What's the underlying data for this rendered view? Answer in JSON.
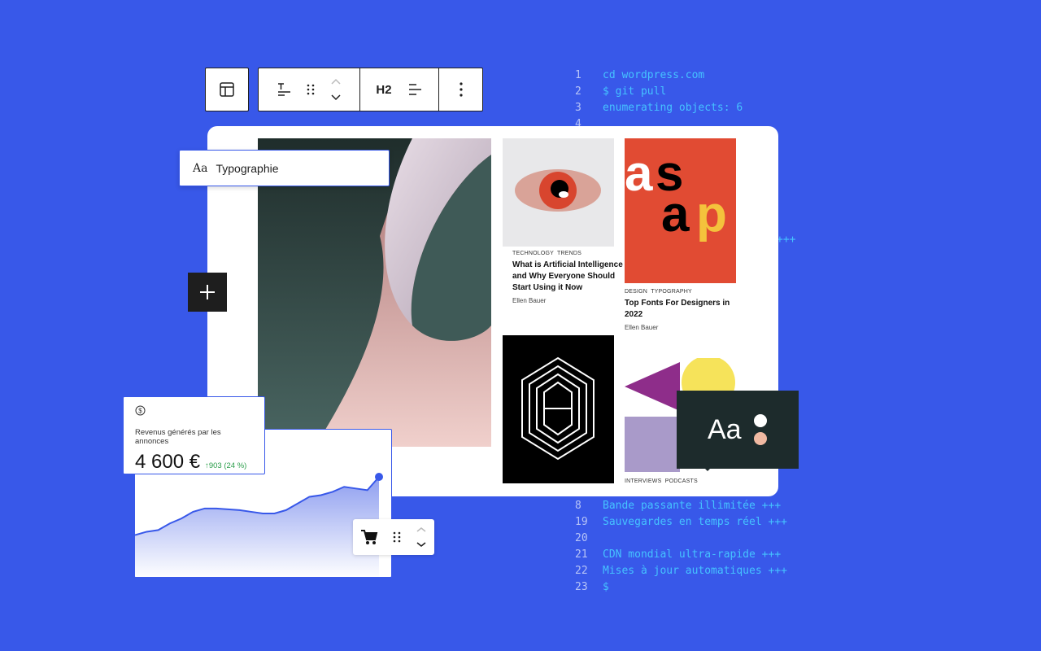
{
  "colors": {
    "background": "#3858e9",
    "accent": "#3858e9",
    "code_text": "#45c3ff",
    "positive": "#2a9d4a"
  },
  "code_lines": [
    {
      "n": "1",
      "t": "cd wordpress.com"
    },
    {
      "n": "2",
      "t": "$ git pull"
    },
    {
      "n": "3",
      "t": "enumerating objects: 6"
    },
    {
      "n": "4",
      "t": ""
    }
  ],
  "code_partial": "+++",
  "code_lines_bottom": [
    {
      "n": "8",
      "t": "Bande passante illimitée +++"
    },
    {
      "n": "19",
      "t": "Sauvegardes en temps réel +++"
    },
    {
      "n": "20",
      "t": ""
    },
    {
      "n": "21",
      "t": "CDN mondial ultra-rapide +++"
    },
    {
      "n": "22",
      "t": "Mises à jour automatiques +++"
    },
    {
      "n": "23",
      "t": "$"
    }
  ],
  "toolbar": {
    "heading_label": "H2"
  },
  "typography_panel": {
    "icon_text": "Aa",
    "label": "Typographie"
  },
  "posts": [
    {
      "tags": "TECHNOLOGY  TRENDS",
      "title": "What is Artificial Intelligence and Why Everyone Should Start Using it Now",
      "author": "Ellen Bauer"
    },
    {
      "tags": "DESIGN  TYPOGRAPHY",
      "title": "Top Fonts For Designers in 2022",
      "author": "Ellen Bauer",
      "image_text": [
        "a",
        "s",
        "a",
        "p"
      ]
    },
    {
      "tags": "INTERVIEWS  PODCASTS"
    }
  ],
  "style_card": {
    "text": "Aa"
  },
  "revenue": {
    "label": "Revenus générés par les annonces",
    "value": "4 600 €",
    "change": "↑903 (24 %)"
  },
  "chart_data": {
    "type": "area",
    "values": [
      10,
      12,
      13,
      17,
      20,
      24,
      26,
      26,
      25.5,
      25,
      24,
      23,
      23,
      25,
      29,
      33,
      34,
      36,
      39,
      38,
      37,
      45
    ]
  }
}
